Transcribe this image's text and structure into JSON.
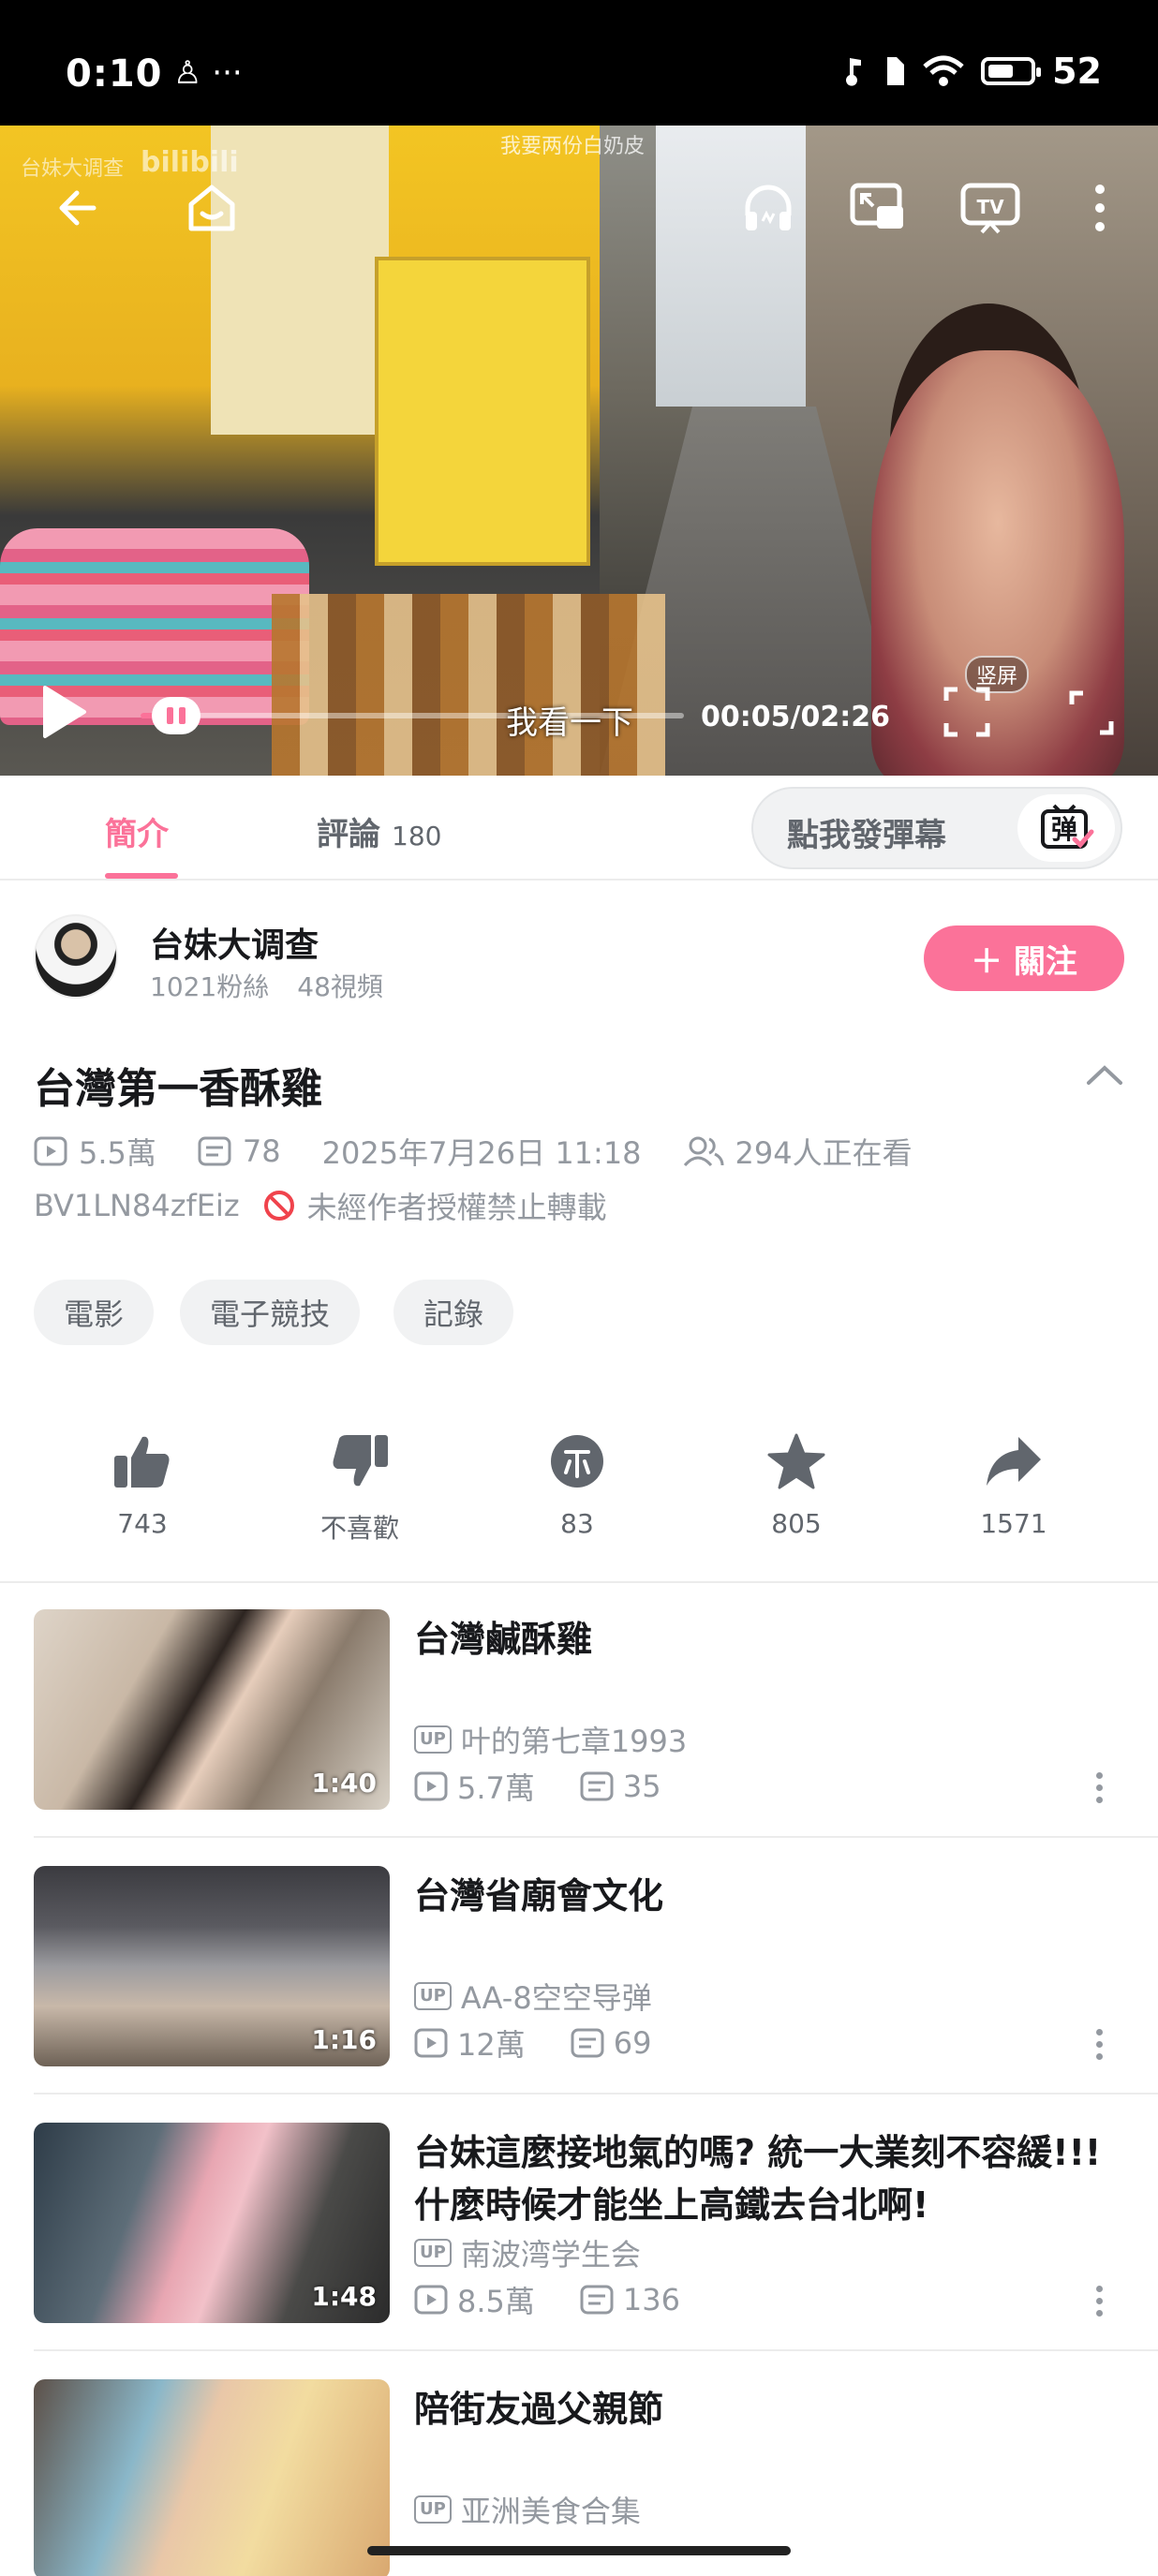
{
  "status_bar": {
    "time": "0:10",
    "left_icons": "♙ ···",
    "battery": "52"
  },
  "video": {
    "watermark_left": "台妹大调查",
    "watermark_brand": "bilibili",
    "watermark_top": "我要两份白奶皮",
    "subtitle": "我看一下",
    "time": "00:05/02:26",
    "vertical_label": "竖屏",
    "progress": 0.034
  },
  "tabs": {
    "intro": "簡介",
    "comments": "評論",
    "comments_count": "180"
  },
  "danmaku": {
    "placeholder": "點我發彈幕",
    "button": "弹"
  },
  "uploader": {
    "name": "台妹大调查",
    "fans": "1021粉絲",
    "videos": "48視頻",
    "follow": "＋ 關注"
  },
  "title": "台灣第一香酥雞",
  "meta": {
    "views": "5.5萬",
    "danmaku": "78",
    "date": "2025年7月26日 11:18",
    "watching": "294人正在看",
    "bvid": "BV1LN84zfEiz",
    "notice": "未經作者授權禁止轉載"
  },
  "tags": [
    "電影",
    "電子競技",
    "記錄"
  ],
  "actions": {
    "like": "743",
    "dislike": "不喜歡",
    "coin": "83",
    "favorite": "805",
    "share": "1571"
  },
  "related": [
    {
      "title": "台灣鹹酥雞",
      "up": "叶的第七章1993",
      "views": "5.7萬",
      "danmaku": "35",
      "duration": "1:40"
    },
    {
      "title": "台灣省廟會文化",
      "up": "AA-8空空导弹",
      "views": "12萬",
      "danmaku": "69",
      "duration": "1:16"
    },
    {
      "title": "台妹這麼接地氣的嗎? 統一大業刻不容緩!!! 什麼時候才能坐上高鐵去台北啊!",
      "up": "南波湾学生会",
      "views": "8.5萬",
      "danmaku": "136",
      "duration": "1:48"
    },
    {
      "title": "陪街友過父親節",
      "up": "亚洲美食合集",
      "views": "",
      "danmaku": "",
      "duration": ""
    }
  ],
  "colors": {
    "accent": "#fb7299",
    "secondary_text": "#9499a0"
  }
}
